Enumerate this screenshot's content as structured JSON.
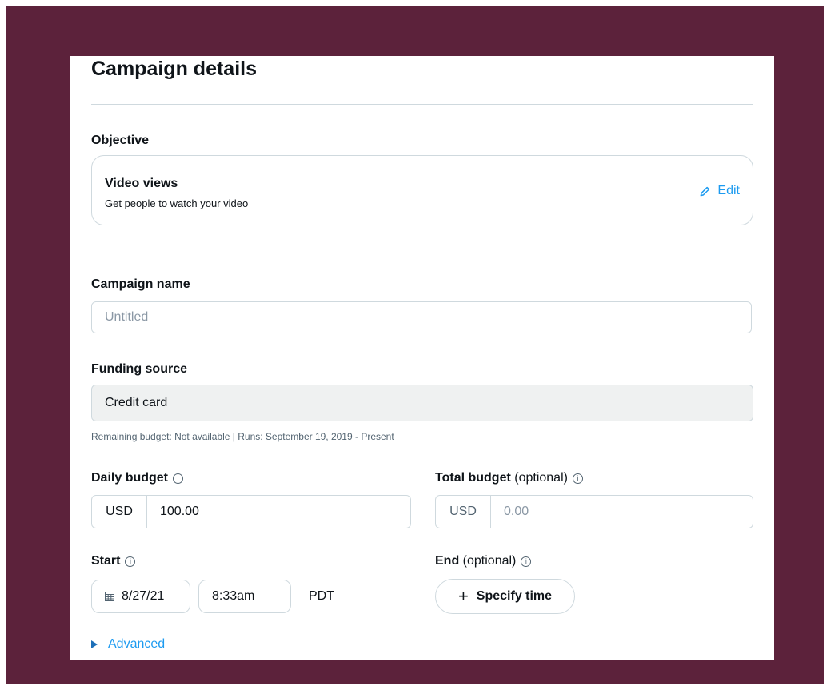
{
  "page": {
    "title": "Campaign details"
  },
  "objective": {
    "label": "Objective",
    "title": "Video views",
    "description": "Get people to watch your video",
    "edit_label": "Edit"
  },
  "campaign_name": {
    "label": "Campaign name",
    "placeholder": "Untitled",
    "value": ""
  },
  "funding_source": {
    "label": "Funding source",
    "value": "Credit card",
    "helper": "Remaining budget: Not available | Runs: September 19, 2019 - Present"
  },
  "daily_budget": {
    "label": "Daily budget",
    "info_icon": "ⓘ",
    "currency": "USD",
    "value": "100.00"
  },
  "total_budget": {
    "label": "Total budget",
    "optional": "(optional)",
    "info_icon": "ⓘ",
    "currency": "USD",
    "placeholder": "0.00"
  },
  "start": {
    "label": "Start",
    "info_icon": "ⓘ",
    "date": "8/27/21",
    "time": "8:33am",
    "timezone": "PDT"
  },
  "end": {
    "label": "End",
    "optional": "(optional)",
    "info_icon": "ⓘ",
    "button_label": "Specify time",
    "button_icon": "+"
  },
  "advanced": {
    "label": "Advanced"
  },
  "colors": {
    "accent": "#1d9bf0",
    "frame": "#5c223b",
    "border": "#cfd9de",
    "disabled_fill": "#eff1f1"
  }
}
